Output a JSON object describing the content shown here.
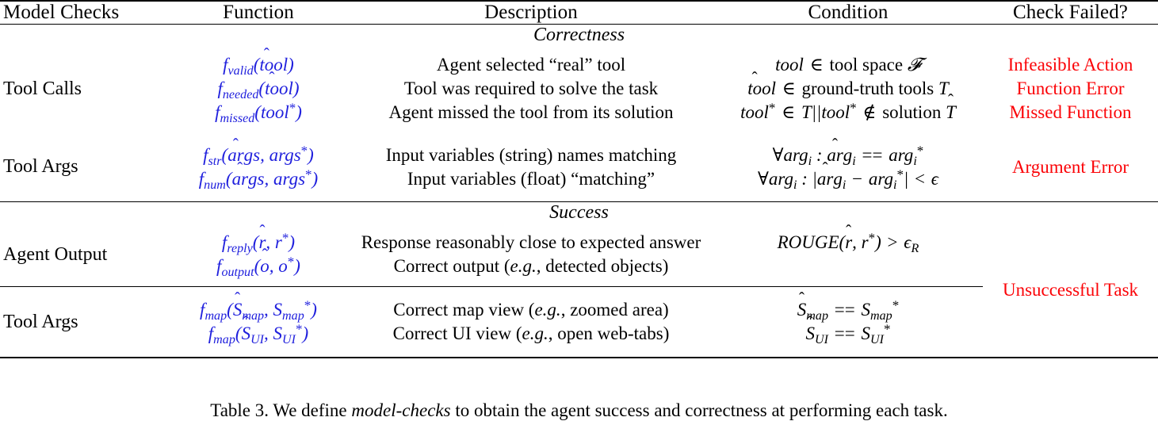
{
  "table": {
    "headers": {
      "model_checks": "Model Checks",
      "function": "Function",
      "description": "Description",
      "condition": "Condition",
      "check_failed": "Check Failed?"
    },
    "groups": [
      {
        "name": "Correctness",
        "rows": [
          {
            "label": "Tool Calls",
            "functions": [
              "f_valid(tôol)",
              "f_needed(tôol)",
              "f_missed(tool*)"
            ],
            "descriptions": [
              "Agent selected “real” tool",
              "Tool was required to solve the task",
              "Agent missed the tool from its solution"
            ],
            "conditions": [
              "tool ∈ tool space 𝒯",
              "tôol ∈ ground-truth tools T",
              "tool* ∈ T||tool* ∉ solution T̂"
            ],
            "failures": [
              "Infeasible Action",
              "Function Error",
              "Missed Function"
            ]
          },
          {
            "label": "Tool Args",
            "functions": [
              "f_str(arĝs, args*)",
              "f_num(arĝs, args*)"
            ],
            "descriptions": [
              "Input variables (string) names matching",
              "Input variables (float) “matching”"
            ],
            "conditions": [
              "∀arg_i : arĝ_i == arg_i*",
              "∀arg_i : |arĝ_i − arg_i*| < ϵ"
            ],
            "failures": [
              "Argument Error"
            ]
          }
        ]
      },
      {
        "name": "Success",
        "rows": [
          {
            "label": "Agent Output",
            "functions": [
              "f_reply(r̂, r*)",
              "f_output(ô, o*)"
            ],
            "descriptions": [
              "Response reasonably close to expected answer",
              "Correct output (e.g., detected objects)"
            ],
            "conditions": [
              "ROUGE(r̂, r*) > ϵ_R",
              ""
            ],
            "failures": [
              "Unsuccessful Task"
            ]
          },
          {
            "label": "Tool Args",
            "functions": [
              "f_map(Ŝ_map, S_map*)",
              "f_map(Ŝ_UI, S_UI*)"
            ],
            "descriptions": [
              "Correct map view (e.g., zoomed area)",
              "Correct UI view (e.g., open web-tabs)"
            ],
            "conditions": [
              "Ŝ_map == S_map*",
              "Ŝ_UI == S_UI*"
            ],
            "failures": []
          }
        ]
      }
    ]
  },
  "caption": {
    "prefix": "Table 3. We define ",
    "emphasis": "model-checks",
    "suffix": " to obtain the agent success and correctness at performing each task."
  },
  "colors": {
    "function_blue": "#2020dd",
    "failure_red": "#fb0307",
    "text": "#000000",
    "background": "#ffffff"
  }
}
